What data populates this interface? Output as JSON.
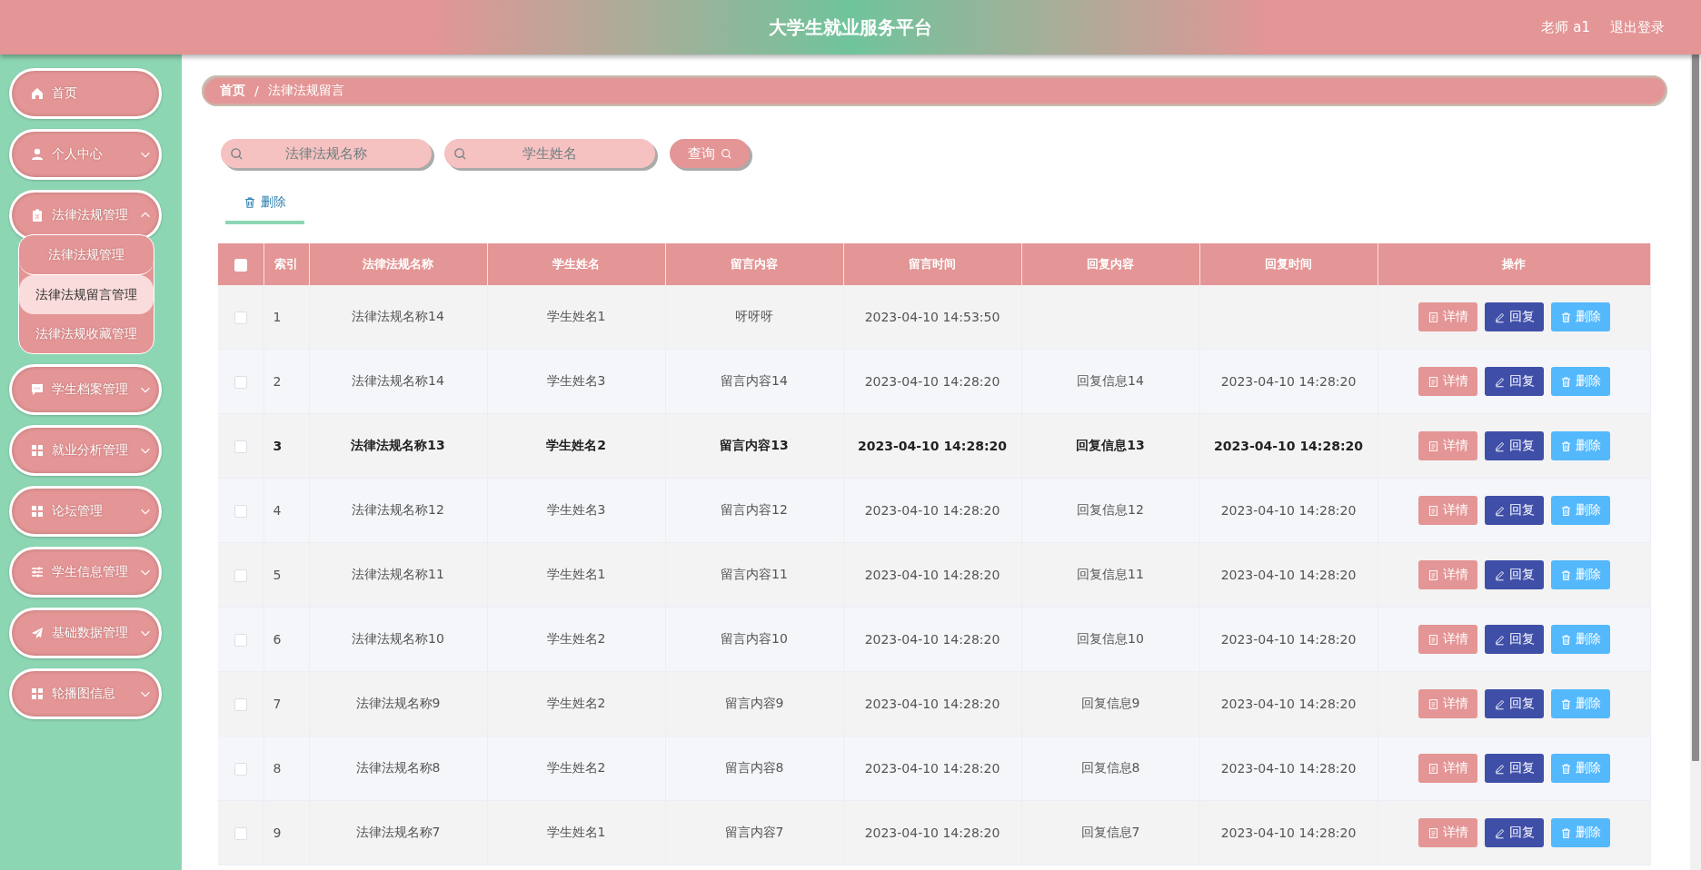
{
  "header": {
    "title": "大学生就业服务平台",
    "user": "老师 a1",
    "logout": "退出登录"
  },
  "sidebar": {
    "items": [
      {
        "label": "首页",
        "kind": "link"
      },
      {
        "label": "个人中心",
        "kind": "group",
        "expanded": false
      },
      {
        "label": "法律法规管理",
        "kind": "group",
        "expanded": true,
        "children": [
          {
            "label": "法律法规管理",
            "selected": false
          },
          {
            "label": "法律法规留言管理",
            "selected": true
          },
          {
            "label": "法律法规收藏管理",
            "selected": false
          }
        ]
      },
      {
        "label": "学生档案管理",
        "kind": "group",
        "expanded": false
      },
      {
        "label": "就业分析管理",
        "kind": "group",
        "expanded": false
      },
      {
        "label": "论坛管理",
        "kind": "group",
        "expanded": false
      },
      {
        "label": "学生信息管理",
        "kind": "group",
        "expanded": false
      },
      {
        "label": "基础数据管理",
        "kind": "group",
        "expanded": false
      },
      {
        "label": "轮播图信息",
        "kind": "group",
        "expanded": false
      }
    ]
  },
  "breadcrumb": {
    "items": [
      "首页",
      "法律法规留言"
    ],
    "separator": "/"
  },
  "search": {
    "fields": [
      {
        "placeholder": "法律法规名称"
      },
      {
        "placeholder": "学生姓名"
      }
    ],
    "button": "查询"
  },
  "toolbar": {
    "delete": "删除"
  },
  "table": {
    "select_all": false,
    "columns": [
      "索引",
      "法律法规名称",
      "学生姓名",
      "留言内容",
      "留言时间",
      "回复内容",
      "回复时间",
      "操作"
    ],
    "rows": [
      {
        "checked": false,
        "hovered": false,
        "cells": [
          "1",
          "法律法规名称14",
          "学生姓名1",
          "呀呀呀",
          "2023-04-10 14:53:50"
        ],
        "actions": [
          "详情",
          "回复",
          "删除"
        ]
      },
      {
        "checked": false,
        "hovered": false,
        "cells": [
          "2",
          "法律法规名称14",
          "学生姓名3",
          "留言内容14",
          "2023-04-10 14:28:20",
          "回复信息14",
          "2023-04-10 14:28:20"
        ],
        "actions": [
          "详情",
          "回复",
          "删除"
        ]
      },
      {
        "checked": false,
        "hovered": true,
        "cells": [
          "3",
          "法律法规名称13",
          "学生姓名2",
          "留言内容13",
          "2023-04-10 14:28:20",
          "回复信息13",
          "2023-04-10 14:28:20"
        ],
        "actions": [
          "详情",
          "回复",
          "删除"
        ]
      },
      {
        "checked": false,
        "hovered": false,
        "cells": [
          "4",
          "法律法规名称12",
          "学生姓名3",
          "留言内容12",
          "2023-04-10 14:28:20",
          "回复信息12",
          "2023-04-10 14:28:20"
        ],
        "actions": [
          "详情",
          "回复",
          "删除"
        ]
      },
      {
        "checked": false,
        "hovered": false,
        "cells": [
          "5",
          "法律法规名称11",
          "学生姓名1",
          "留言内容11",
          "2023-04-10 14:28:20",
          "回复信息11",
          "2023-04-10 14:28:20"
        ],
        "actions": [
          "详情",
          "回复",
          "删除"
        ]
      },
      {
        "checked": false,
        "hovered": false,
        "cells": [
          "6",
          "法律法规名称10",
          "学生姓名2",
          "留言内容10",
          "2023-04-10 14:28:20",
          "回复信息10",
          "2023-04-10 14:28:20"
        ],
        "actions": [
          "详情",
          "回复",
          "删除"
        ]
      },
      {
        "checked": false,
        "hovered": false,
        "cells": [
          "7",
          "法律法规名称9",
          "学生姓名2",
          "留言内容9",
          "2023-04-10 14:28:20",
          "回复信息9",
          "2023-04-10 14:28:20"
        ],
        "actions": [
          "详情",
          "回复",
          "删除"
        ]
      },
      {
        "checked": false,
        "hovered": false,
        "cells": [
          "8",
          "法律法规名称8",
          "学生姓名2",
          "留言内容8",
          "2023-04-10 14:28:20",
          "回复信息8",
          "2023-04-10 14:28:20"
        ],
        "actions": [
          "详情",
          "回复",
          "删除"
        ]
      },
      {
        "checked": false,
        "hovered": false,
        "cells": [
          "9",
          "法律法规名称7",
          "学生姓名1",
          "留言内容7",
          "2023-04-10 14:28:20",
          "回复信息7",
          "2023-04-10 14:28:20"
        ],
        "actions": [
          "详情",
          "回复",
          "删除"
        ]
      }
    ]
  }
}
